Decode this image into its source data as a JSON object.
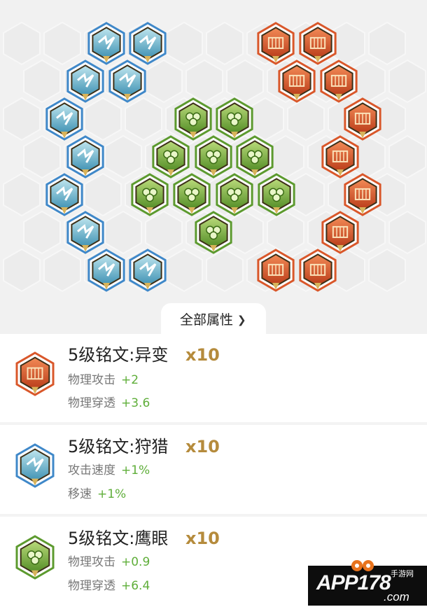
{
  "board": {
    "toggle_label": "全部属性",
    "toggle_icon": "chevron-down-icon"
  },
  "rune_colors": {
    "red": "#d9572a",
    "blue": "#3f88c9",
    "green": "#5c9a2e"
  },
  "runes": [
    {
      "title": "5级铭文:异变",
      "count": "x10",
      "color": "red",
      "attrs": [
        {
          "name": "物理攻击",
          "value": "+2"
        },
        {
          "name": "物理穿透",
          "value": "+3.6"
        }
      ]
    },
    {
      "title": "5级铭文:狩猎",
      "count": "x10",
      "color": "blue",
      "attrs": [
        {
          "name": "攻击速度",
          "value": "+1%"
        },
        {
          "name": "移速",
          "value": "+1%"
        }
      ]
    },
    {
      "title": "5级铭文:鹰眼",
      "count": "x10",
      "color": "green",
      "attrs": [
        {
          "name": "物理攻击",
          "value": "+0.9"
        },
        {
          "name": "物理穿透",
          "value": "+6.4"
        }
      ]
    }
  ],
  "watermark": {
    "brand": "APP178",
    "sub": "手游网",
    "domain": ".com"
  }
}
